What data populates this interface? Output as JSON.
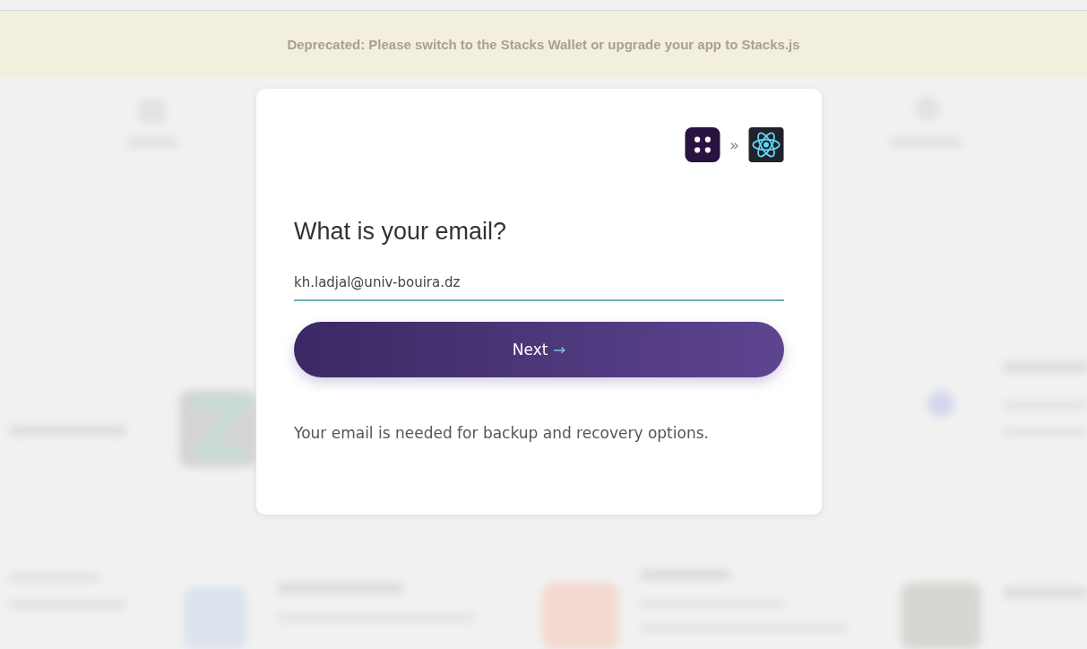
{
  "banner": {
    "text": "Deprecated: Please switch to the Stacks Wallet or upgrade your app to Stacks.js"
  },
  "modal": {
    "separator": "»",
    "title": "What is your email?",
    "email_field": {
      "value": "kh.ladjal@univ-bouira.dz"
    },
    "next_button": {
      "label": "Next",
      "arrow": "→"
    },
    "note": "Your email is needed for backup and recovery options."
  }
}
